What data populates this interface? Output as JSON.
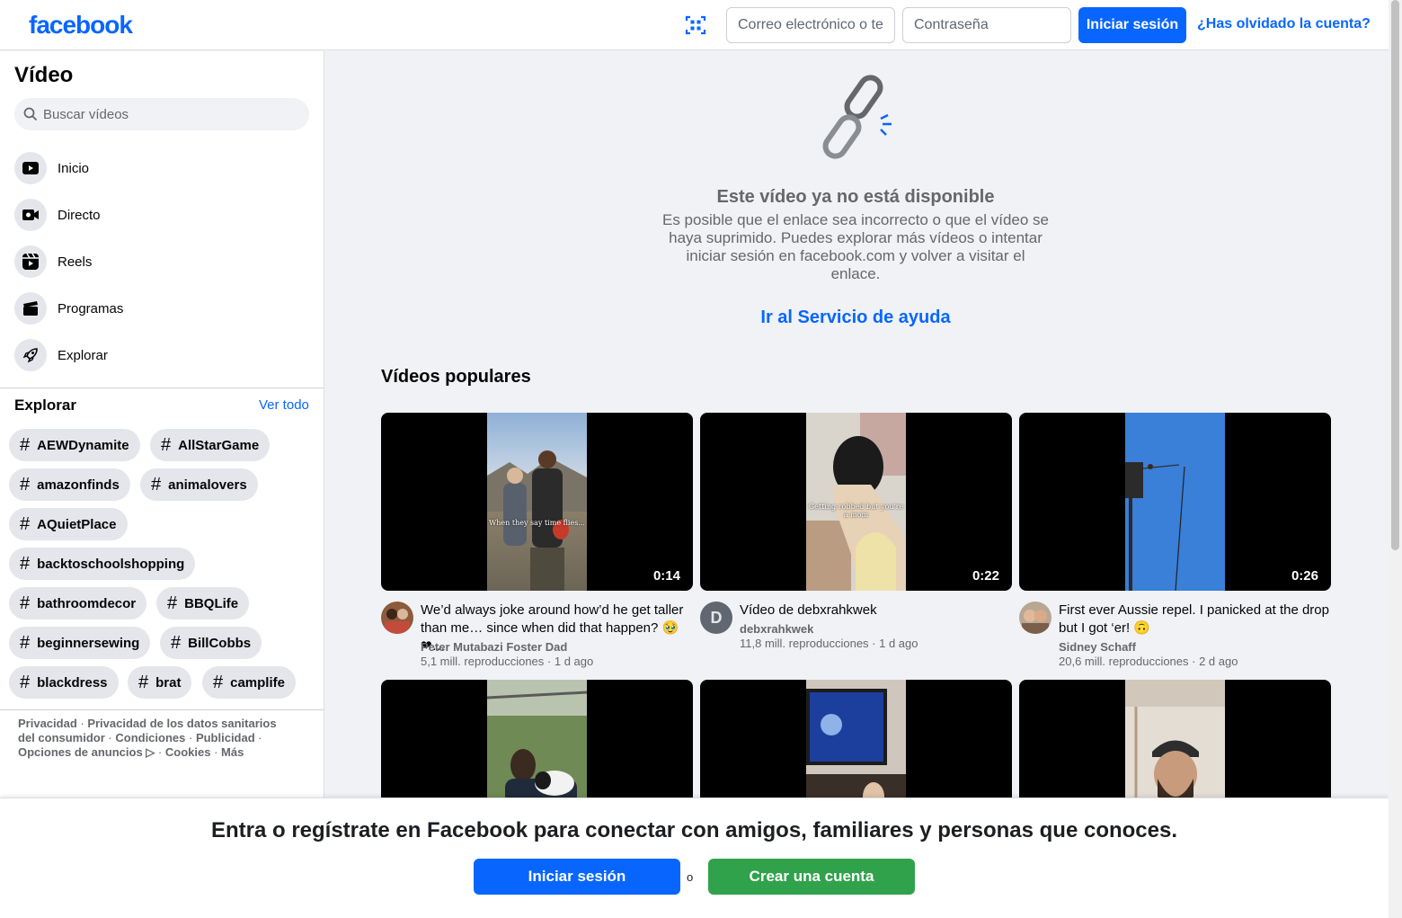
{
  "header": {
    "logo": "facebook",
    "email_placeholder": "Correo electrónico o teléfono",
    "password_placeholder": "Contraseña",
    "login_label": "Iniciar sesión",
    "forgot_label": "¿Has olvidado la cuenta?"
  },
  "sidebar": {
    "title": "Vídeo",
    "search_placeholder": "Buscar vídeos",
    "nav": [
      {
        "label": "Inicio",
        "icon": "play-icon"
      },
      {
        "label": "Directo",
        "icon": "live-camera-icon"
      },
      {
        "label": "Reels",
        "icon": "reels-icon"
      },
      {
        "label": "Programas",
        "icon": "clapperboard-icon"
      },
      {
        "label": "Explorar",
        "icon": "rocket-icon"
      }
    ],
    "explore_heading": "Explorar",
    "see_all": "Ver todo",
    "tags": [
      "AEWDynamite",
      "AllStarGame",
      "amazonfinds",
      "animalovers",
      "AQuietPlace",
      "backtoschoolshopping",
      "bathroomdecor",
      "BBQLife",
      "beginnersewing",
      "BillCobbs",
      "blackdress",
      "brat",
      "camplife"
    ],
    "footer": {
      "privacy": "Privacidad",
      "health_privacy": "Privacidad de los datos sanitarios del consumidor",
      "terms": "Condiciones",
      "ads": "Publicidad",
      "ad_choices": "Opciones de anuncios ▷",
      "cookies": "Cookies",
      "more": "Más"
    }
  },
  "main": {
    "unavailable_title": "Este vídeo ya no está disponible",
    "unavailable_body": "Es posible que el enlace sea incorrecto o que el vídeo se haya suprimido. Puedes explorar más vídeos o intentar iniciar sesión en facebook.com y volver a visitar el enlace.",
    "help_link": "Ir al Servicio de ayuda",
    "popular_heading": "Vídeos populares",
    "videos": [
      {
        "title": "We’d always joke around how’d he get taller than me… since when did that happen? 🥹❤…",
        "author": "Peter Mutabazi Foster Dad",
        "views": "5,1 mill. reproducciones",
        "age": "1 d ago",
        "duration": "0:14",
        "caption": "When they say time flies..."
      },
      {
        "title": "Vídeo de debxrahkwek",
        "author": "debxrahkwek",
        "avatar_letter": "D",
        "views": "11,8 mill. reproducciones",
        "age": "1 d ago",
        "duration": "0:22",
        "caption": "Getting robbed but you're a mom"
      },
      {
        "title": "First ever Aussie repel. I panicked at the drop but I got ‘er! 🙃",
        "author": "Sidney Schaff",
        "views": "20,6 mill. reproducciones",
        "age": "2 d ago",
        "duration": "0:26"
      }
    ]
  },
  "banner": {
    "text": "Entra o regístrate en Facebook para conectar con amigos, familiares y personas que conoces.",
    "login_label": "Iniciar sesión",
    "or": "o",
    "create_label": "Crear una cuenta"
  },
  "colors": {
    "brand": "#0866ff",
    "create_green": "#31a24c"
  }
}
